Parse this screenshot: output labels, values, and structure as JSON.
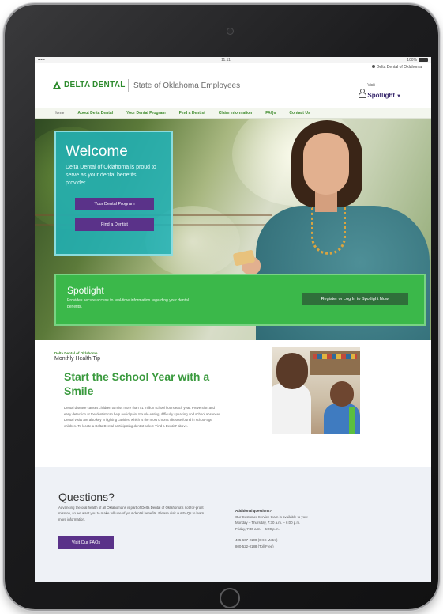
{
  "status": {
    "carrier": "•••••",
    "time": "11:11",
    "battery": "100%"
  },
  "header": {
    "top_link": "Delta Dental of Oklahoma",
    "logo_text": "DELTA DENTAL",
    "subtitle": "State of Oklahoma Employees",
    "visit_label": "Visit",
    "spotlight_label": "Spotlight"
  },
  "nav": {
    "items": [
      "Home",
      "About Delta Dental",
      "Your Dental Program",
      "Find a Dentist",
      "Claim Information",
      "FAQs",
      "Contact Us"
    ]
  },
  "hero": {
    "welcome_title": "Welcome",
    "welcome_text": "Delta Dental of Oklahoma is proud to serve as your dental benefits provider.",
    "btn_program": "Your Dental Program",
    "btn_find": "Find a Dentist",
    "spotlight_title": "Spotlight",
    "spotlight_text": "Provides secure access to real-time information regarding your dental benefits.",
    "spotlight_btn": "Register or Log In to Spotlight Now!"
  },
  "tip": {
    "org": "Delta Dental of Oklahoma",
    "label": "Monthly Health Tip",
    "title": "Start the School Year with a Smile",
    "body": "Dental disease causes children to miss more than 51 million school hours each year. Prevention and early detection at the dentist can help avoid pain, trouble eating, difficulty speaking and school absences. Dental visits are also key in fighting cavities, which is the most chronic disease found in school-age children. To locate a Delta Dental participating dentist select 'Find a Dentist' above."
  },
  "questions": {
    "title": "Questions?",
    "desc": "Advancing the oral health of all Oklahomans is part of Delta Dental of Oklahoma's not-for-profit mission, so we want you to make full use of your dental benefits. Please visit our FAQs to learn more information.",
    "btn": "Visit Our FAQs",
    "add_heading": "Additional questions?",
    "add_line1": "Our Customer Service team is available to you:",
    "add_line2": "Monday – Thursday, 7:30 a.m. – 6:00 p.m.",
    "add_line3": "Friday, 7:30 a.m. – 5:00 p.m.",
    "phone1": "405-607-2100 (OKC Metro)",
    "phone2": "800-522-0188 (Toll-Free)"
  }
}
